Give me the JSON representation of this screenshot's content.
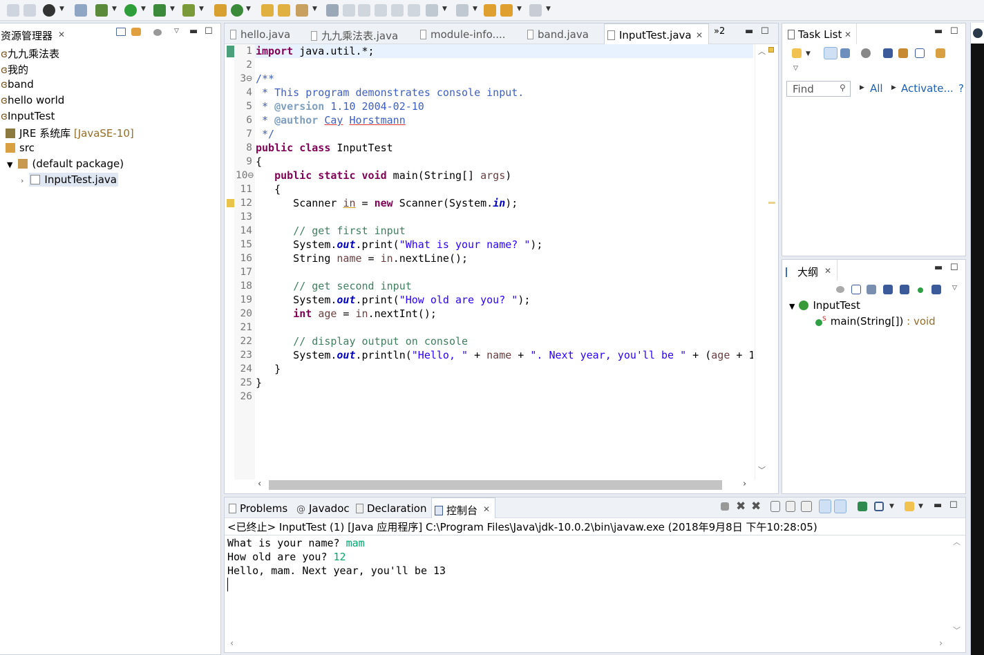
{
  "left_panel": {
    "title": "资源管理器",
    "items": [
      {
        "label": "九九乘法表"
      },
      {
        "label": "我的"
      },
      {
        "label": "band"
      },
      {
        "label": "hello world"
      },
      {
        "label": "InputTest"
      },
      {
        "label": "JRE 系统库",
        "suffix": "[JavaSE-10]"
      },
      {
        "label": "src"
      },
      {
        "label": "(default package)"
      },
      {
        "label": "InputTest.java"
      }
    ]
  },
  "editor": {
    "tabs": [
      {
        "label": "hello.java"
      },
      {
        "label": "九九乘法表.java"
      },
      {
        "label": "module-info...."
      },
      {
        "label": "band.java"
      },
      {
        "label": "InputTest.java"
      }
    ],
    "overflow": "»2",
    "line_numbers": [
      "1",
      "2",
      "3⊖",
      "4",
      "5",
      "6",
      "7",
      "8",
      "9",
      "10⊖",
      "11",
      "12",
      "13",
      "14",
      "15",
      "16",
      "17",
      "18",
      "19",
      "20",
      "21",
      "22",
      "23",
      "24",
      "25",
      "26"
    ]
  },
  "task_list": {
    "title": "Task List",
    "find_placeholder": "Find",
    "all_label": "All",
    "activate_label": "Activate...",
    "help": "?"
  },
  "outline": {
    "title": "大纲",
    "class_name": "InputTest",
    "method": "main(String[])",
    "method_type": " : void",
    "static_mark": "S"
  },
  "console": {
    "tabs": [
      {
        "label": "Problems"
      },
      {
        "label": "Javadoc"
      },
      {
        "label": "Declaration"
      },
      {
        "label": "控制台"
      }
    ],
    "status": "<已终止> InputTest (1)  [Java 应用程序] C:\\Program Files\\Java\\jdk-10.0.2\\bin\\javaw.exe (2018年9月8日 下午10:28:05)",
    "lines": [
      {
        "prompt": "What is your name? ",
        "input": "mam"
      },
      {
        "prompt": "How old are you? ",
        "input": "12"
      },
      {
        "prompt": "Hello, mam. Next year, you'll be 13",
        "input": ""
      }
    ]
  },
  "colors": {
    "keyword": "#7f0055",
    "comment": "#3f7f5f",
    "javadoc": "#3f5fbf",
    "string": "#2a00ff",
    "field": "#0000c0",
    "console_input": "#00a86b",
    "link": "#1a5fb4"
  }
}
